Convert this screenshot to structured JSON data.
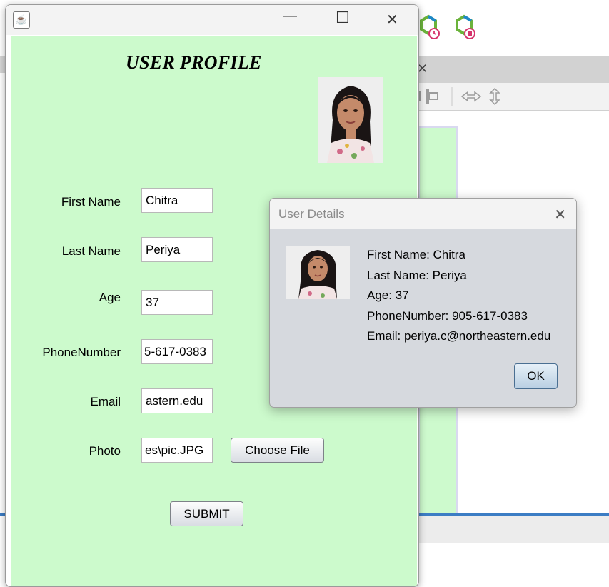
{
  "window": {
    "minimize_glyph": "—",
    "maximize_glyph": "☐",
    "close_glyph": "✕",
    "app_icon": "java-icon"
  },
  "form": {
    "title": "USER PROFILE",
    "fields": [
      {
        "label": "First Name",
        "value": "Chitra"
      },
      {
        "label": "Last Name",
        "value": "Periya"
      },
      {
        "label": "Age",
        "value": "37"
      },
      {
        "label": "PhoneNumber",
        "value": "5-617-0383"
      },
      {
        "label": "Email",
        "value": "astern.edu"
      },
      {
        "label": "Photo",
        "value": "es\\pic.JPG"
      }
    ],
    "choose_file_label": "Choose File",
    "submit_label": "SUBMIT",
    "background_color": "#ccfacc"
  },
  "dialog": {
    "title": "User Details",
    "lines": [
      "First Name: Chitra",
      "Last Name: Periya",
      "Age: 37",
      "PhoneNumber: 905-617-0383",
      "Email: periya.c@northeastern.edu"
    ],
    "ok_label": "OK"
  },
  "background_ide": {
    "tab_close_glyph": "✕",
    "accent_color": "#3c7dc4"
  }
}
